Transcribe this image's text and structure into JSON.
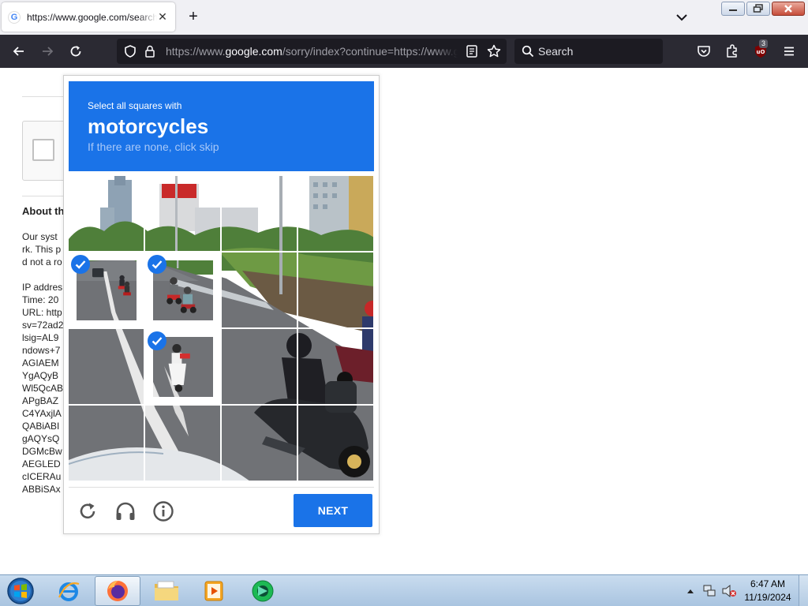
{
  "browser": {
    "tab_title": "https://www.google.com/search",
    "favicon_letter": "G",
    "url_prefix": "https://www.",
    "url_host": "google.com",
    "url_rest": "/sorry/index?continue=https://www.goog",
    "search_placeholder": "Search",
    "extension_badge": "3",
    "icons": [
      "back-icon",
      "forward-icon",
      "reload-icon",
      "shield-icon",
      "lock-icon",
      "reader-view-icon",
      "bookmark-star-icon",
      "search-icon",
      "pocket-icon",
      "extensions-icon",
      "ublock-icon",
      "menu-icon"
    ]
  },
  "page": {
    "about_title": "About th",
    "lines": [
      "Our syst",
      "rk. This p",
      "d not a ro",
      "",
      "IP addres",
      "Time: 20",
      "URL: http",
      "sv=72ad2",
      "lsig=AL9",
      "ndows+7",
      "AGIAEM",
      "YgAQyB",
      "Wl5QcAB",
      "APgBAZ",
      "C4YAxjlA",
      "QABiABI",
      "gAQYsQ",
      "DGMcBw",
      "AEGLED",
      "cICERAu",
      "ABBiSAx"
    ]
  },
  "challenge": {
    "instruction": "Select all squares with",
    "target": "motorcycles",
    "hint": "If there are none, click skip",
    "next_label": "NEXT",
    "selected_tiles": [
      4,
      5,
      9
    ],
    "accent_color": "#1a73e8"
  },
  "taskbar": {
    "apps": [
      "internet-explorer",
      "firefox",
      "file-explorer",
      "media-player",
      "app-green"
    ],
    "time": "6:47 AM",
    "date": "11/19/2024"
  }
}
